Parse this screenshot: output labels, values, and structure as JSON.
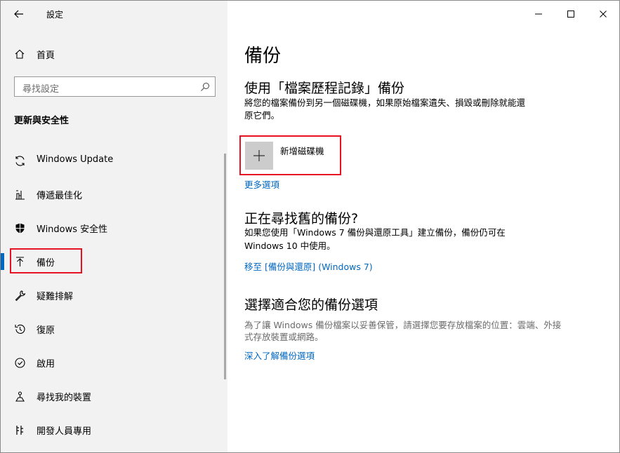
{
  "window": {
    "title": "設定",
    "minimize_icon": "minimize-icon",
    "maximize_icon": "maximize-icon",
    "close_icon": "close-icon"
  },
  "sidebar": {
    "home_label": "首頁",
    "search_placeholder": "尋找設定",
    "section_title": "更新與安全性",
    "items": [
      {
        "label": "Windows Update",
        "icon": "refresh-icon"
      },
      {
        "label": "傳遞最佳化",
        "icon": "delivery-optimization-icon"
      },
      {
        "label": "Windows 安全性",
        "icon": "shield-icon"
      },
      {
        "label": "備份",
        "icon": "backup-arrow-icon",
        "selected": true
      },
      {
        "label": "疑難排解",
        "icon": "wrench-icon"
      },
      {
        "label": "復原",
        "icon": "recovery-icon"
      },
      {
        "label": "啟用",
        "icon": "check-circle-icon"
      },
      {
        "label": "尋找我的裝置",
        "icon": "find-device-icon"
      },
      {
        "label": "開發人員專用",
        "icon": "developer-icon"
      }
    ]
  },
  "main": {
    "title": "備份",
    "file_history": {
      "heading": "使用「檔案歷程記錄」備份",
      "description_line1": "將您的檔案備份到另一個磁碟機，如果原始檔案遺失、損毀或刪除就能還",
      "description_line2": "原它們。",
      "add_drive_label": "新增磁碟機",
      "more_options_link": "更多選項"
    },
    "old_backup": {
      "heading": "正在尋找舊的備份?",
      "description_line1": "如果您使用「Windows 7 備份與還原工具」建立備份，備份仍可在",
      "description_line2": "Windows 10 中使用。",
      "link": "移至 [備份與還原] (Windows 7)"
    },
    "choose_option": {
      "heading": "選擇適合您的備份選項",
      "description_line1": "為了讓 Windows 備份檔案以妥善保管，請選擇您要存放檔案的位置：雲端、外接",
      "description_line2": "式存放裝置或網路。",
      "link": "深入了解備份選項"
    }
  },
  "colors": {
    "accent": "#0067c0",
    "highlight_border": "#e81123",
    "sidebar_bg": "#f2f2f2"
  }
}
